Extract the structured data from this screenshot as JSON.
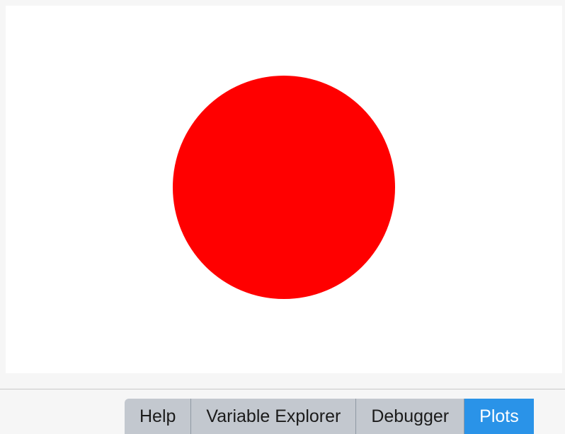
{
  "plot": {
    "circle_color": "#ff0000"
  },
  "tabs": [
    {
      "label": "Help",
      "active": false
    },
    {
      "label": "Variable Explorer",
      "active": false
    },
    {
      "label": "Debugger",
      "active": false
    },
    {
      "label": "Plots",
      "active": true
    }
  ],
  "colors": {
    "active_tab": "#2a93e8",
    "inactive_tab": "#c3c8cf"
  }
}
